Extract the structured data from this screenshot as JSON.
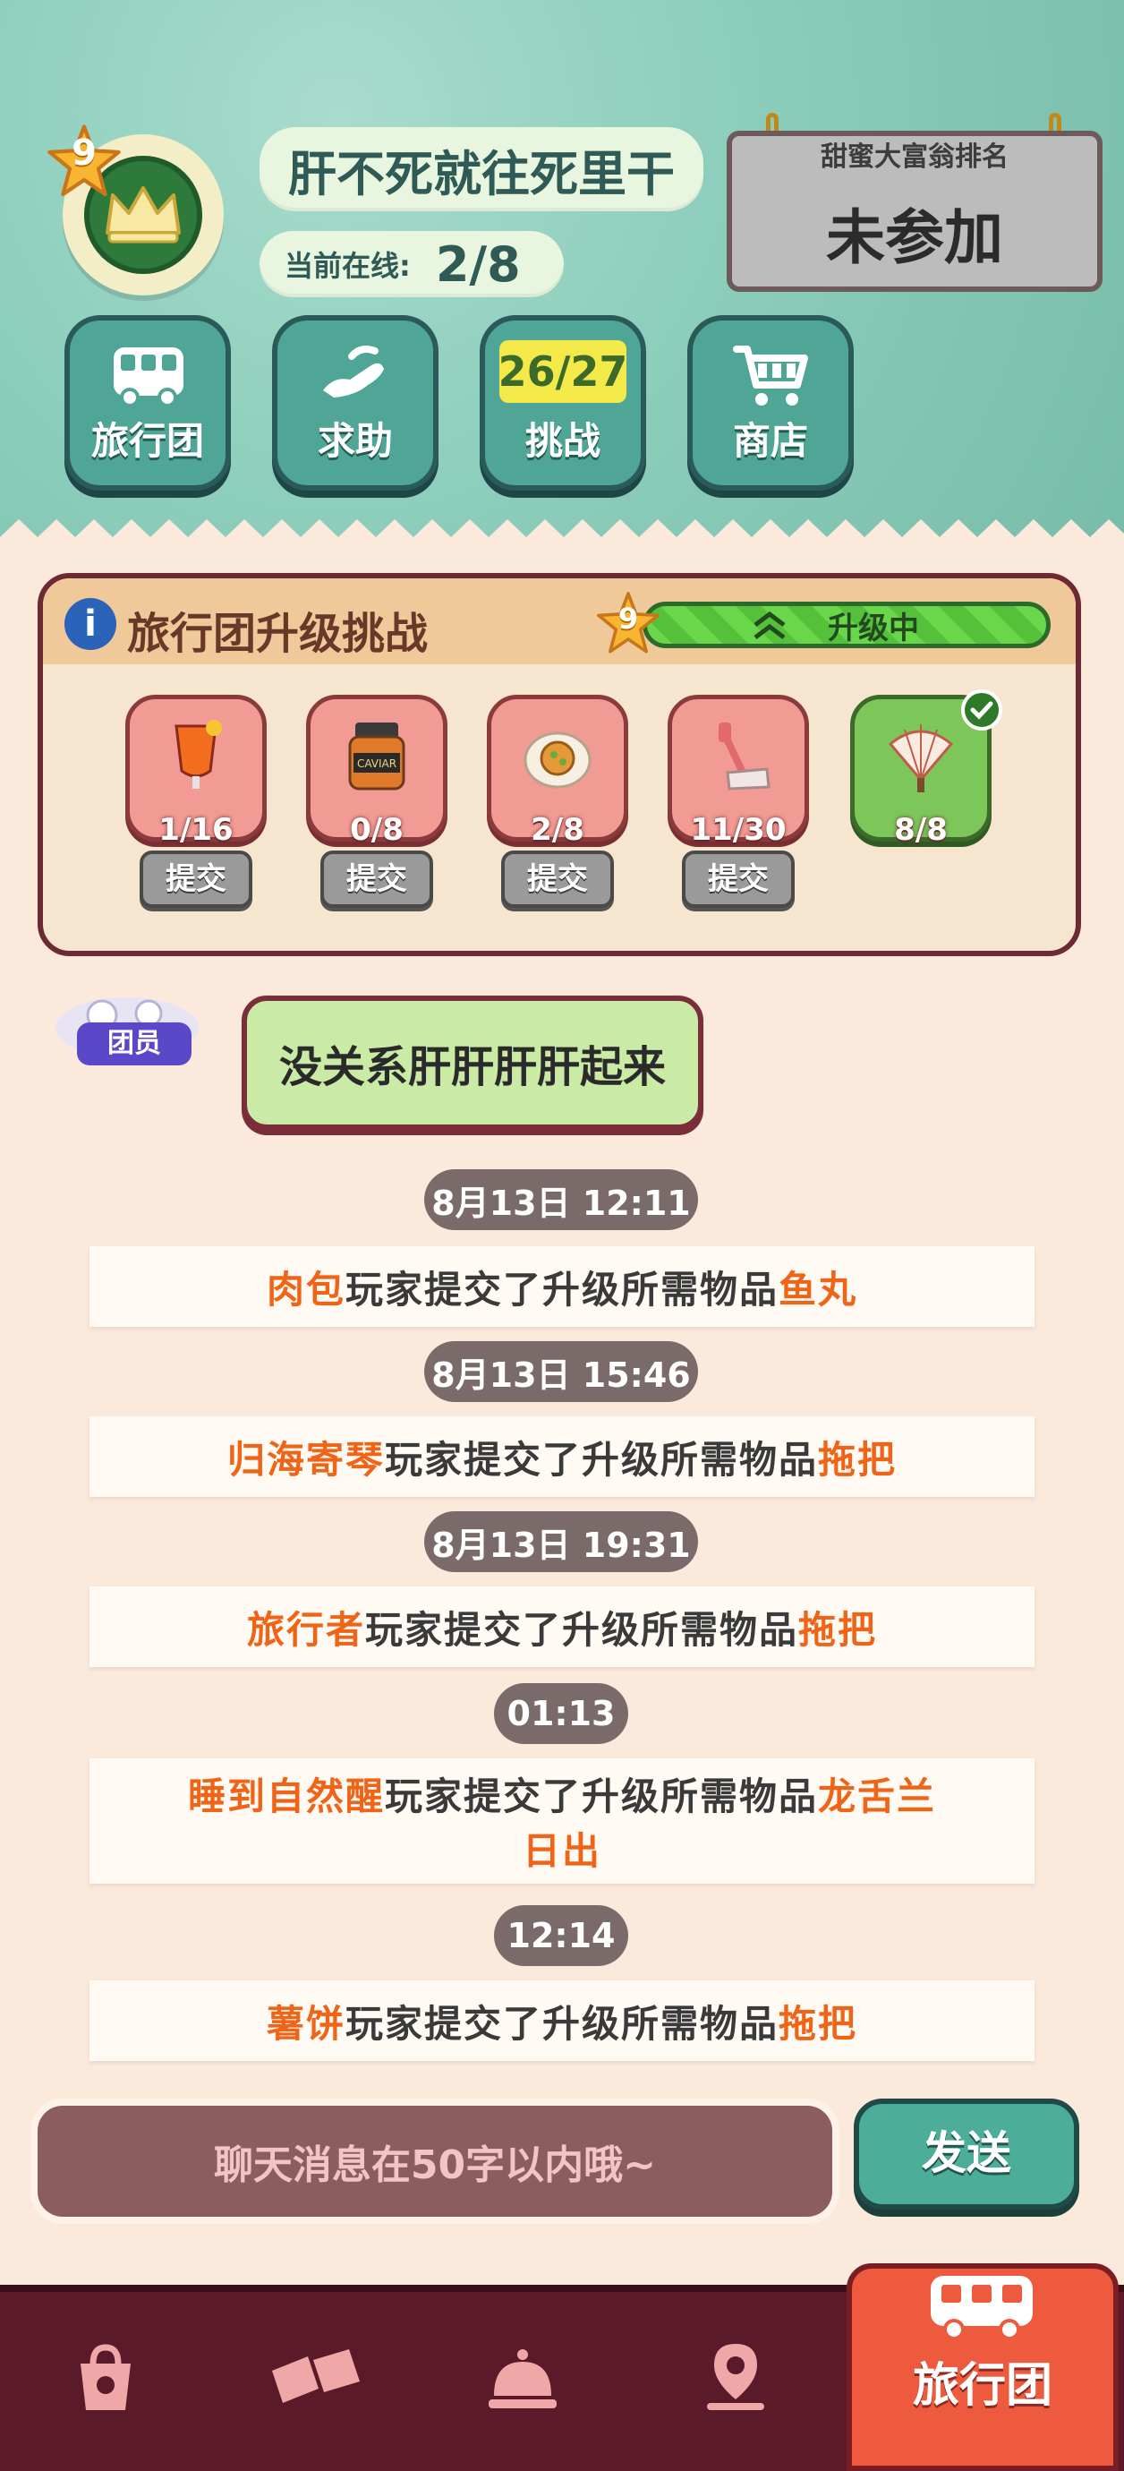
{
  "header": {
    "team_name": "肝不死就往死里干",
    "online_label": "当前在线:",
    "online_value": "2/8",
    "level": "9"
  },
  "ranking": {
    "title": "甜蜜大富翁排名",
    "value": "未参加"
  },
  "nav": [
    {
      "label": "旅行团",
      "icon": "bus-icon"
    },
    {
      "label": "求助",
      "icon": "helping-hand-icon"
    },
    {
      "label": "挑战",
      "icon": "challenge-icon",
      "count": "26/27"
    },
    {
      "label": "商店",
      "icon": "cart-icon"
    }
  ],
  "challenge": {
    "title": "旅行团升级挑战",
    "level": "9",
    "status": "升级中",
    "submit_label": "提交",
    "items": [
      {
        "name": "cocktail",
        "qty": "1/16",
        "done": false
      },
      {
        "name": "caviar",
        "qty": "0/8",
        "done": false,
        "jar_text": "CAVIAR"
      },
      {
        "name": "pastry-plate",
        "qty": "2/8",
        "done": false
      },
      {
        "name": "mop",
        "qty": "11/30",
        "done": false
      },
      {
        "name": "paper-fan",
        "qty": "8/8",
        "done": true
      }
    ]
  },
  "chat": {
    "member_tag": "团员",
    "message": "没关系肝肝肝肝起来"
  },
  "log": [
    {
      "time": "8月13日 12:11",
      "player": "肉包",
      "text": "玩家提交了升级所需物品",
      "item": "鱼丸"
    },
    {
      "time": "8月13日 15:46",
      "player": "归海寄琴",
      "text": "玩家提交了升级所需物品",
      "item": "拖把"
    },
    {
      "time": "8月13日 19:31",
      "player": "旅行者",
      "text": "玩家提交了升级所需物品",
      "item": "拖把"
    },
    {
      "time": "01:13",
      "player": "睡到自然醒",
      "text": "玩家提交了升级所需物品",
      "item": "龙舌兰",
      "item2": "日出"
    },
    {
      "time": "12:14",
      "player": "薯饼",
      "text": "玩家提交了升级所需物品",
      "item": "拖把"
    }
  ],
  "input": {
    "placeholder": "聊天消息在50字以内哦~",
    "send_label": "发送"
  },
  "bottom_nav": {
    "tabs": [
      "bag-icon",
      "tickets-icon",
      "service-bell-icon",
      "map-pin-icon"
    ],
    "active_label": "旅行团"
  },
  "colors": {
    "accent_orange": "#f06418",
    "teal": "#4fa696",
    "maroon": "#5a1a2a",
    "active_tab": "#ee5a3e"
  }
}
